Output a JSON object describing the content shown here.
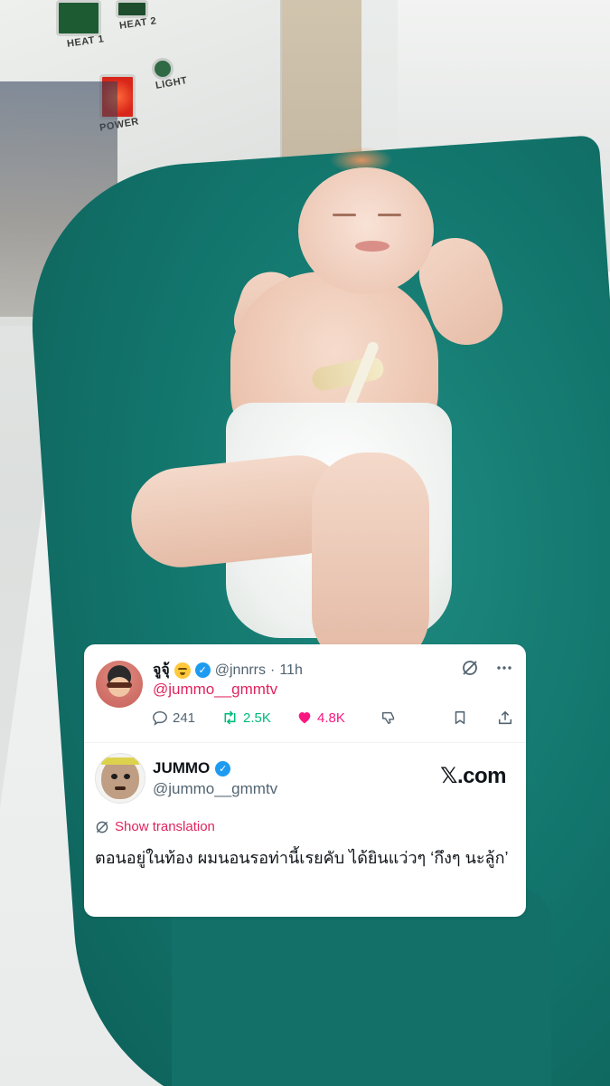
{
  "photo": {
    "panel": {
      "heat1_label": "HEAT 1",
      "heat2_label": "HEAT 2",
      "power_label": "POWER",
      "light_label": "LIGHT"
    }
  },
  "reply": {
    "display_name": "จูจุ้",
    "handle": "@jnnrrs",
    "time_separator": "·",
    "time": "11h",
    "mention": "@jummo__gmmtv",
    "stats": {
      "replies": "241",
      "reposts": "2.5K",
      "likes": "4.8K"
    }
  },
  "quoted": {
    "display_name": "JUMMO",
    "handle": "@jummo__gmmtv",
    "brand": "𝕏.com",
    "show_translation": "Show translation",
    "text": "ตอนอยู่ในท้อง ผมนอนรอท่านี้เรยคับ ได้ยินแว่วๆ ‘กึงๆ นะลู้ก’"
  },
  "colors": {
    "verified": "#1d9bf0",
    "pink_link": "#e0245e",
    "repost_green": "#00ba7c",
    "like_pink": "#f91880",
    "muted": "#536471"
  },
  "icons": [
    "smile-emoji-icon",
    "verified-badge-icon",
    "grok-icon",
    "more-icon",
    "reply-icon",
    "repost-icon",
    "like-icon",
    "dislike-icon",
    "bookmark-icon",
    "share-icon",
    "translate-icon"
  ]
}
